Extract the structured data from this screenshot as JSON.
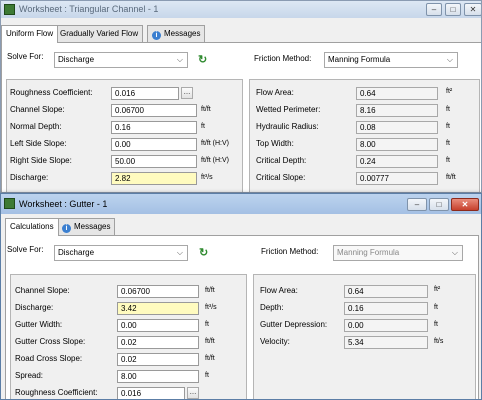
{
  "window1": {
    "title": "Worksheet : Triangular Channel - 1",
    "tabs": [
      "Uniform Flow",
      "Gradually Varied Flow",
      "Messages"
    ],
    "solve_for": {
      "label": "Solve For:",
      "value": "Discharge"
    },
    "friction": {
      "label": "Friction Method:",
      "value": "Manning Formula"
    },
    "inputs": [
      {
        "label": "Roughness Coefficient:",
        "value": "0.016",
        "unit": ""
      },
      {
        "label": "Channel Slope:",
        "value": "0.06700",
        "unit": "ft/ft"
      },
      {
        "label": "Normal Depth:",
        "value": "0.16",
        "unit": "ft"
      },
      {
        "label": "Left Side Slope:",
        "value": "0.00",
        "unit": "ft/ft (H:V)"
      },
      {
        "label": "Right Side Slope:",
        "value": "50.00",
        "unit": "ft/ft (H:V)"
      },
      {
        "label": "Discharge:",
        "value": "2.82",
        "unit": "ft³/s"
      }
    ],
    "results": [
      {
        "label": "Flow Area:",
        "value": "0.64",
        "unit": "ft²"
      },
      {
        "label": "Wetted Perimeter:",
        "value": "8.16",
        "unit": "ft"
      },
      {
        "label": "Hydraulic Radius:",
        "value": "0.08",
        "unit": "ft"
      },
      {
        "label": "Top Width:",
        "value": "8.00",
        "unit": "ft"
      },
      {
        "label": "Critical Depth:",
        "value": "0.24",
        "unit": "ft"
      },
      {
        "label": "Critical Slope:",
        "value": "0.00777",
        "unit": "ft/ft"
      }
    ]
  },
  "window2": {
    "title": "Worksheet : Gutter - 1",
    "tabs": [
      "Calculations",
      "Messages"
    ],
    "solve_for": {
      "label": "Solve For:",
      "value": "Discharge"
    },
    "friction": {
      "label": "Friction Method:",
      "value": "Manning Formula"
    },
    "inputs": [
      {
        "label": "Channel Slope:",
        "value": "0.06700",
        "unit": "ft/ft"
      },
      {
        "label": "Discharge:",
        "value": "3.42",
        "unit": "ft³/s"
      },
      {
        "label": "Gutter Width:",
        "value": "0.00",
        "unit": "ft"
      },
      {
        "label": "Gutter Cross Slope:",
        "value": "0.02",
        "unit": "ft/ft"
      },
      {
        "label": "Road Cross Slope:",
        "value": "0.02",
        "unit": "ft/ft"
      },
      {
        "label": "Spread:",
        "value": "8.00",
        "unit": "ft"
      },
      {
        "label": "Roughness Coefficient:",
        "value": "0.016",
        "unit": ""
      }
    ],
    "results": [
      {
        "label": "Flow Area:",
        "value": "0.64",
        "unit": "ft²"
      },
      {
        "label": "Depth:",
        "value": "0.16",
        "unit": "ft"
      },
      {
        "label": "Gutter Depression:",
        "value": "0.00",
        "unit": "ft"
      },
      {
        "label": "Velocity:",
        "value": "5.34",
        "unit": "ft/s"
      }
    ]
  },
  "icons": {
    "refresh": "refresh-icon",
    "info": "info-icon",
    "ellipsis": "ellipsis-button"
  },
  "colors": {
    "highlight_field": "#fffbbf",
    "title_active": "#a4c0e4",
    "close": "#c6402c"
  }
}
